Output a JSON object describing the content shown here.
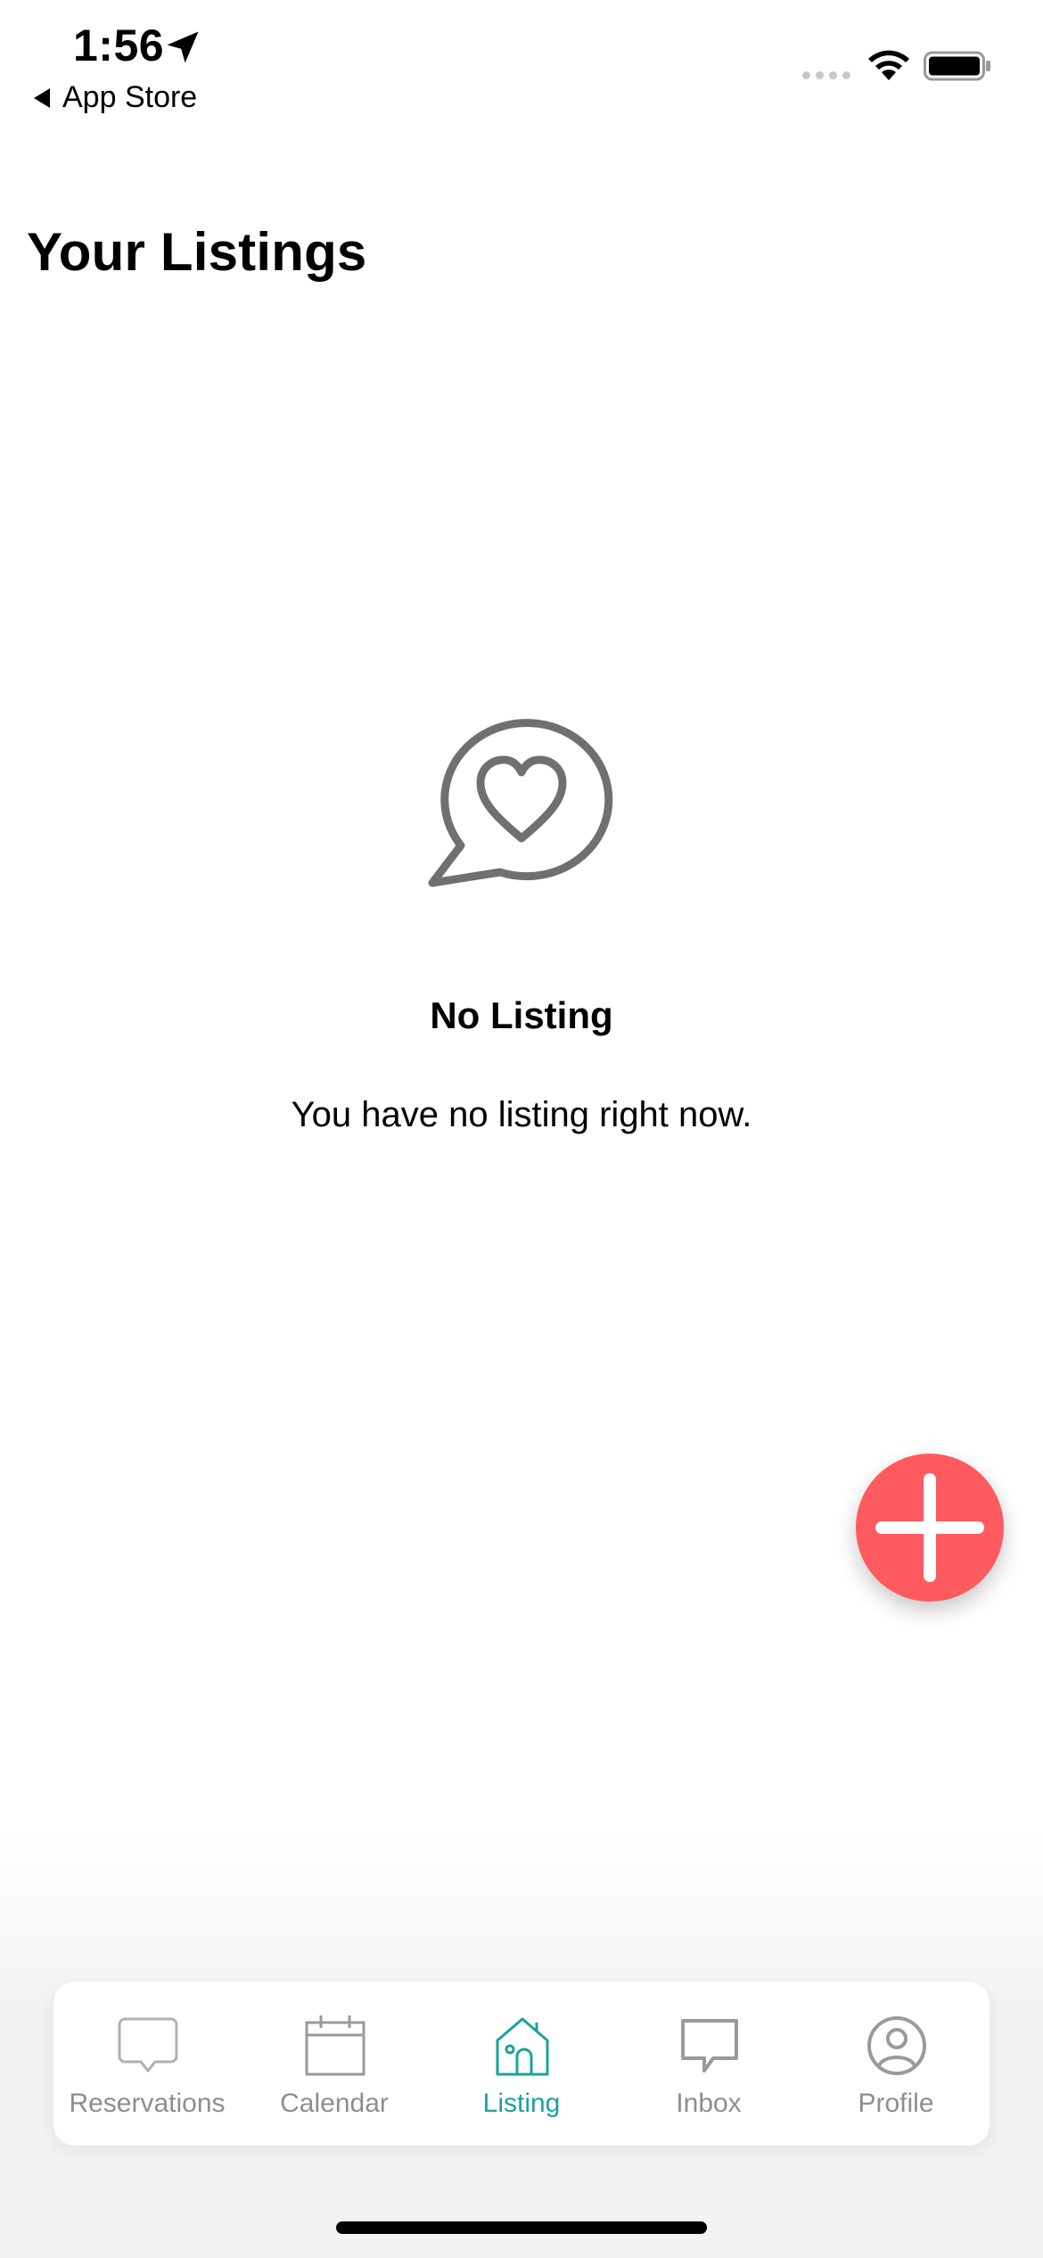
{
  "status_bar": {
    "time": "1:56",
    "back_label": "App Store"
  },
  "header": {
    "title": "Your Listings"
  },
  "empty_state": {
    "icon": "heart-speech-bubble-icon",
    "title": "No Listing",
    "message": "You have no listing right now."
  },
  "fab": {
    "icon": "plus-icon",
    "color": "#ff5a60"
  },
  "tab_bar": {
    "active_color": "#1ba39c",
    "inactive_color": "#8e8e8e",
    "tabs": [
      {
        "label": "Reservations",
        "icon": "chat-bubble-icon",
        "active": false
      },
      {
        "label": "Calendar",
        "icon": "calendar-icon",
        "active": false
      },
      {
        "label": "Listing",
        "icon": "house-icon",
        "active": true
      },
      {
        "label": "Inbox",
        "icon": "message-icon",
        "active": false
      },
      {
        "label": "Profile",
        "icon": "user-circle-icon",
        "active": false
      }
    ]
  }
}
